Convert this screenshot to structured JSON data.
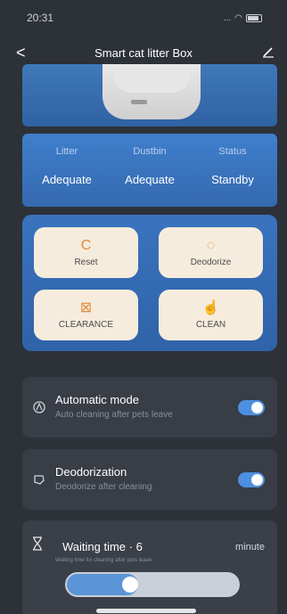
{
  "status_bar": {
    "time": "20:31",
    "signal": "..."
  },
  "nav": {
    "back": "<",
    "title": "Smart cat litter Box"
  },
  "info": [
    {
      "label": "Litter",
      "value": "Adequate"
    },
    {
      "label": "Dustbin",
      "value": "Adequate"
    },
    {
      "label": "Status",
      "value": "Standby"
    }
  ],
  "actions": {
    "reset": {
      "label": "Reset",
      "icon": "C"
    },
    "deodorize": {
      "label": "Deodorize",
      "icon": "◌"
    },
    "clearance": {
      "label": "CLEARANCE",
      "icon": "⊠"
    },
    "clean": {
      "label": "CLEAN",
      "icon": "☝"
    }
  },
  "automatic": {
    "title": "Automatic mode",
    "subtitle": "Auto cleaning after pets leave",
    "enabled": true
  },
  "deodorization": {
    "title": "Deodorization",
    "subtitle": "Deodorize after cleaning",
    "enabled": true
  },
  "waiting": {
    "title": "Waiting time · 6",
    "unit": "minute",
    "subtitle": "Waiting time for cleaning after pets leave",
    "value_fraction": 0.35
  },
  "colors": {
    "accent": "#4d8fe0",
    "action_icon": "#e08a3c",
    "background": "#2d3138"
  }
}
